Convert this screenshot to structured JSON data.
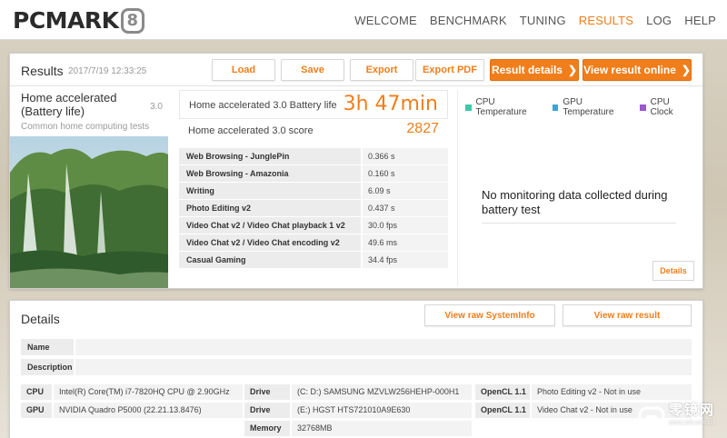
{
  "app": {
    "logo_text": "PCMARK",
    "logo_badge": "8"
  },
  "nav": [
    "WELCOME",
    "BENCHMARK",
    "TUNING",
    "RESULTS",
    "LOG",
    "HELP"
  ],
  "results": {
    "title": "Results",
    "date": "2017/7/19 12:33:25",
    "buttons": {
      "load": "Load",
      "save": "Save",
      "export": "Export",
      "export_pdf": "Export PDF"
    },
    "result_details": "Result details",
    "view_online": "View result online"
  },
  "benchmark": {
    "name": "Home accelerated (Battery life)",
    "version": "3.0",
    "subtitle": "Common home computing tests"
  },
  "scores": {
    "battery_label": "Home accelerated 3.0 Battery life",
    "battery_value": "3h 47min",
    "score_label": "Home accelerated 3.0 score",
    "score_value": "2827"
  },
  "subtests": [
    {
      "name": "Web Browsing - JunglePin",
      "value": "0.366 s"
    },
    {
      "name": "Web Browsing - Amazonia",
      "value": "0.160 s"
    },
    {
      "name": "Writing",
      "value": "6.09 s"
    },
    {
      "name": "Photo Editing v2",
      "value": "0.437 s"
    },
    {
      "name": "Video Chat v2 / Video Chat playback 1 v2",
      "value": "30.0 fps"
    },
    {
      "name": "Video Chat v2 / Video Chat encoding v2",
      "value": "49.6 ms"
    },
    {
      "name": "Casual Gaming",
      "value": "34.4 fps"
    }
  ],
  "monitoring": {
    "legend": [
      {
        "label": "CPU Temperature",
        "color": "#3cc9a8"
      },
      {
        "label": "GPU Temperature",
        "color": "#35a6e0"
      },
      {
        "label": "CPU Clock",
        "color": "#9b59c9"
      }
    ],
    "message": "No monitoring data collected during battery test",
    "details_button": "Details"
  },
  "details": {
    "title": "Details",
    "systeminfo_button": "View raw SystemInfo",
    "raw_result_button": "View raw result",
    "fields": {
      "name_label": "Name",
      "description_label": "Description"
    },
    "hardware": {
      "cpu_label": "CPU",
      "cpu_value": "Intel(R) Core(TM) i7-7820HQ CPU @ 2.90GHz",
      "gpu_label": "GPU",
      "gpu_value": "NVIDIA Quadro P5000 (22.21.13.8476)",
      "drive1_label": "Drive",
      "drive1_value": "(C: D:) SAMSUNG MZVLW256HEHP-000H1",
      "drive2_label": "Drive",
      "drive2_value": "(E:) HGST HTS721010A9E630",
      "memory_label": "Memory",
      "memory_value": "32768MB",
      "opencl1_label": "OpenCL 1.1",
      "opencl1_value": "Photo Editing v2 - Not in use",
      "opencl2_label": "OpenCL 1.1",
      "opencl2_value": "Video Chat v2 - Not in use"
    }
  },
  "watermark": {
    "text": "零镜网",
    "sub": "www.zol.com.cn"
  },
  "colors": {
    "accent": "#f07e1b"
  }
}
